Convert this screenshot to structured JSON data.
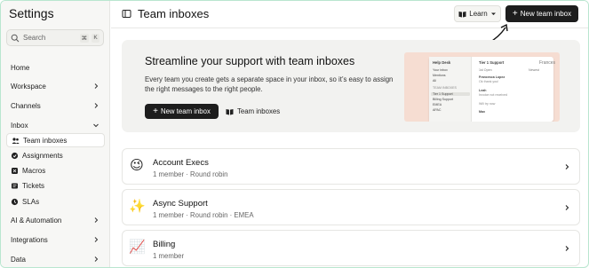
{
  "sidebar": {
    "title": "Settings",
    "search": {
      "placeholder": "Search",
      "shortcut_keys": [
        "⌘",
        "K"
      ]
    },
    "items": [
      {
        "label": "Home",
        "has_chevron": false
      },
      {
        "label": "Workspace",
        "has_chevron": true
      },
      {
        "label": "Channels",
        "has_chevron": true
      },
      {
        "label": "Inbox",
        "has_chevron": true,
        "expanded": true
      },
      {
        "label": "Team inboxes",
        "icon": "people-icon",
        "active": true
      },
      {
        "label": "Assignments",
        "icon": "assign-icon"
      },
      {
        "label": "Macros",
        "icon": "macro-icon"
      },
      {
        "label": "Tickets",
        "icon": "ticket-icon"
      },
      {
        "label": "SLAs",
        "icon": "sla-icon"
      },
      {
        "label": "AI & Automation",
        "has_chevron": true
      },
      {
        "label": "Integrations",
        "has_chevron": true
      },
      {
        "label": "Data",
        "has_chevron": true
      }
    ]
  },
  "header": {
    "title": "Team inboxes",
    "learn_label": "Learn",
    "new_button_label": "New team inbox"
  },
  "banner": {
    "title": "Streamline your support with team inboxes",
    "description": "Every team you create gets a separate space in your inbox, so it’s easy to assign the right messages to the right people.",
    "primary_label": "New team inbox",
    "secondary_label": "Team inboxes",
    "art": {
      "left_title": "Help Desk",
      "left_items": [
        "Your inbox",
        "Mentions",
        "All",
        "TEAM INBOXES",
        "Tier 1 Support",
        "Billing Support",
        "EMEA",
        "APAC"
      ],
      "right_title": "Tier 1 Support",
      "right_header_left": "1st Open",
      "right_header_right": "Newest",
      "right_rows": [
        "Francesca Lopez",
        "Ok thank you!",
        "Leah",
        "Invoice not received",
        "Will try now",
        "Max"
      ],
      "corner_text": "Frances"
    }
  },
  "inboxes": [
    {
      "name": "Account Execs",
      "meta": "1 member · Round robin",
      "emoji": "😉"
    },
    {
      "name": "Async Support",
      "meta": "1 member · Round robin · EMEA",
      "emoji": "✨"
    },
    {
      "name": "Billing",
      "meta": "1 member",
      "emoji": "📈"
    }
  ],
  "colors": {
    "accent_dark": "#1d1d1d",
    "sidebar_bg": "#f7f7f5",
    "banner_bg": "#f2f2f0",
    "art_bg": "#f6ddd2"
  }
}
